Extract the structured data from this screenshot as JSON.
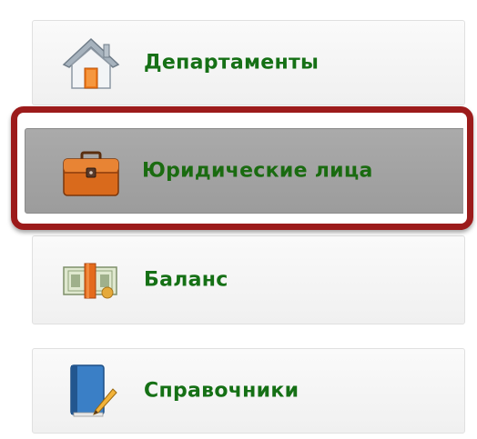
{
  "menu": {
    "items": [
      {
        "label": "Департаменты",
        "icon": "house-icon"
      },
      {
        "label": "Юридические лица",
        "icon": "briefcase-icon"
      },
      {
        "label": "Баланс",
        "icon": "money-stack-icon"
      },
      {
        "label": "Справочники",
        "icon": "book-pen-icon"
      }
    ],
    "selected_index": 1
  },
  "colors": {
    "label_green": "#157015",
    "highlight_red": "#9c1b1b",
    "selected_bg": "#a3a3a3",
    "item_bg": "#f4f4f4"
  }
}
